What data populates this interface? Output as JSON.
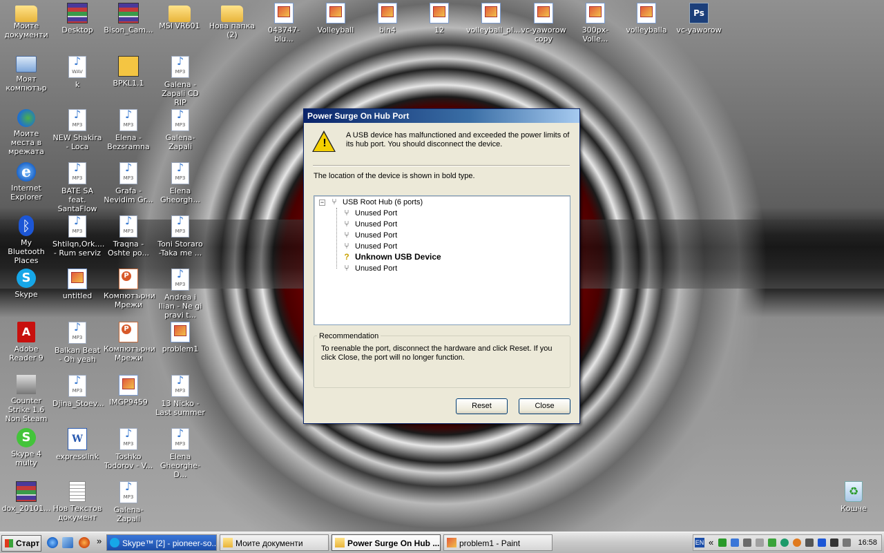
{
  "desktop": {
    "icons": [
      {
        "label": "Моите документи",
        "icon": "my-documents-icon"
      },
      {
        "label": "Desktop",
        "icon": "rar-archive-icon"
      },
      {
        "label": "Bison_Cam...",
        "icon": "rar-archive-icon"
      },
      {
        "label": "MSI VR601",
        "icon": "folder-icon"
      },
      {
        "label": "Нова папка (2)",
        "icon": "folder-icon"
      },
      {
        "label": "043747-blu...",
        "icon": "image-file-icon"
      },
      {
        "label": "Volleyball",
        "icon": "image-file-icon"
      },
      {
        "label": "bin4",
        "icon": "image-file-icon"
      },
      {
        "label": "12",
        "icon": "image-file-icon"
      },
      {
        "label": "volleyball_pl...",
        "icon": "image-file-icon"
      },
      {
        "label": "vc-yaworow copy",
        "icon": "image-file-icon"
      },
      {
        "label": "300px-Volle...",
        "icon": "image-file-icon"
      },
      {
        "label": "volleyballa",
        "icon": "image-file-icon"
      },
      {
        "label": "vc-yaworow",
        "icon": "psd-file-icon"
      },
      {
        "label": "Моят компютър",
        "icon": "my-computer-icon"
      },
      {
        "label": "k",
        "icon": "wav-file-icon"
      },
      {
        "label": "BPKL1.1",
        "icon": "installer-icon"
      },
      {
        "label": "Galena - Zapali CD RIP",
        "icon": "mp3-file-icon"
      },
      {
        "label": "Моите места в мрежата",
        "icon": "network-places-icon"
      },
      {
        "label": "NEW Shakira - Loca",
        "icon": "mp3-file-icon"
      },
      {
        "label": "Elena - Bezsramna",
        "icon": "mp3-file-icon"
      },
      {
        "label": "Galena-Zapali",
        "icon": "mp3-file-icon"
      },
      {
        "label": "Internet Explorer",
        "icon": "internet-explorer-icon"
      },
      {
        "label": "BATE SA feat. SantaFlow a...",
        "icon": "mp3-file-icon"
      },
      {
        "label": "Grafa - Nevidim Gr...",
        "icon": "mp3-file-icon"
      },
      {
        "label": "Elena Gheorgh...",
        "icon": "mp3-file-icon"
      },
      {
        "label": "My Bluetooth Places",
        "icon": "bluetooth-icon"
      },
      {
        "label": "Shtilqn,Ork.... - Rum serviz",
        "icon": "mp3-file-icon"
      },
      {
        "label": "Traqna - Oshte po...",
        "icon": "mp3-file-icon"
      },
      {
        "label": "Toni Storaro -Taka me ...",
        "icon": "mp3-file-icon"
      },
      {
        "label": "Skype",
        "icon": "skype-icon"
      },
      {
        "label": "untitled",
        "icon": "image-file-icon"
      },
      {
        "label": "Компютърни Мрежи",
        "icon": "powerpoint-file-icon"
      },
      {
        "label": "Andrea i Ilian - Ne gi pravi t...",
        "icon": "mp3-file-icon"
      },
      {
        "label": "Adobe Reader 9",
        "icon": "adobe-reader-icon"
      },
      {
        "label": "Balkan Beat - Oh yeah",
        "icon": "mp3-file-icon"
      },
      {
        "label": "Компютърни Мрежи",
        "icon": "powerpoint-file-icon"
      },
      {
        "label": "problem1",
        "icon": "image-file-icon"
      },
      {
        "label": "Counter Strike 1.6 Non Steam",
        "icon": "counter-strike-icon"
      },
      {
        "label": "Djina_Stoev...",
        "icon": "mp3-file-icon"
      },
      {
        "label": "IMGP9459",
        "icon": "image-file-icon"
      },
      {
        "label": "13 Nicko - Last summer",
        "icon": "mp3-file-icon"
      },
      {
        "label": "Skype 4 multy",
        "icon": "skype-green-icon"
      },
      {
        "label": "expresslink",
        "icon": "word-file-icon"
      },
      {
        "label": "Toshko Todorov - V...",
        "icon": "mp3-file-icon"
      },
      {
        "label": "Elena Gheorghe-D...",
        "icon": "mp3-file-icon"
      },
      {
        "label": "dox_20101...",
        "icon": "rar-archive-icon"
      },
      {
        "label": "Нов Текстов документ",
        "icon": "text-file-icon"
      },
      {
        "label": "Galena-Zapali",
        "icon": "mp3-file-icon"
      },
      {
        "label": "Кошче",
        "icon": "recycle-bin-icon"
      }
    ]
  },
  "dialog": {
    "title": "Power Surge On Hub Port",
    "message": "A USB device has malfunctioned and exceeded the power limits of its hub port. You should disconnect the device.",
    "location_text": "The location of the device is shown in bold type.",
    "tree": {
      "root": "USB Root Hub (6 ports)",
      "expander": "−",
      "ports": [
        {
          "label": "Unused Port",
          "bold": false
        },
        {
          "label": "Unused Port",
          "bold": false
        },
        {
          "label": "Unused Port",
          "bold": false
        },
        {
          "label": "Unused Port",
          "bold": false
        },
        {
          "label": "Unknown USB Device",
          "bold": true
        },
        {
          "label": "Unused Port",
          "bold": false
        }
      ]
    },
    "recommendation_title": "Recommendation",
    "recommendation_text": "To reenable the port, disconnect the hardware and click Reset. If you click Close, the port will no longer function.",
    "reset_label": "Reset",
    "close_label": "Close"
  },
  "taskbar": {
    "start_label": "Старт",
    "overflow": "»",
    "tasks": [
      {
        "label": "Skype™ [2] - pioneer-so...",
        "icon": "skype-icon",
        "active": false
      },
      {
        "label": "Моите документи",
        "icon": "folder-icon",
        "active": false
      },
      {
        "label": "Power Surge On Hub ...",
        "icon": "folder-icon",
        "active": true
      },
      {
        "label": "problem1 - Paint",
        "icon": "paint-icon",
        "active": false
      }
    ],
    "tray": {
      "language": "EN",
      "chevron": "«",
      "clock": "16:58"
    }
  },
  "colors": {
    "titlebar_start": "#0a246a",
    "titlebar_end": "#a6caf0",
    "dialog_bg": "#ece9d8",
    "warning_yellow": "#f5d000"
  }
}
